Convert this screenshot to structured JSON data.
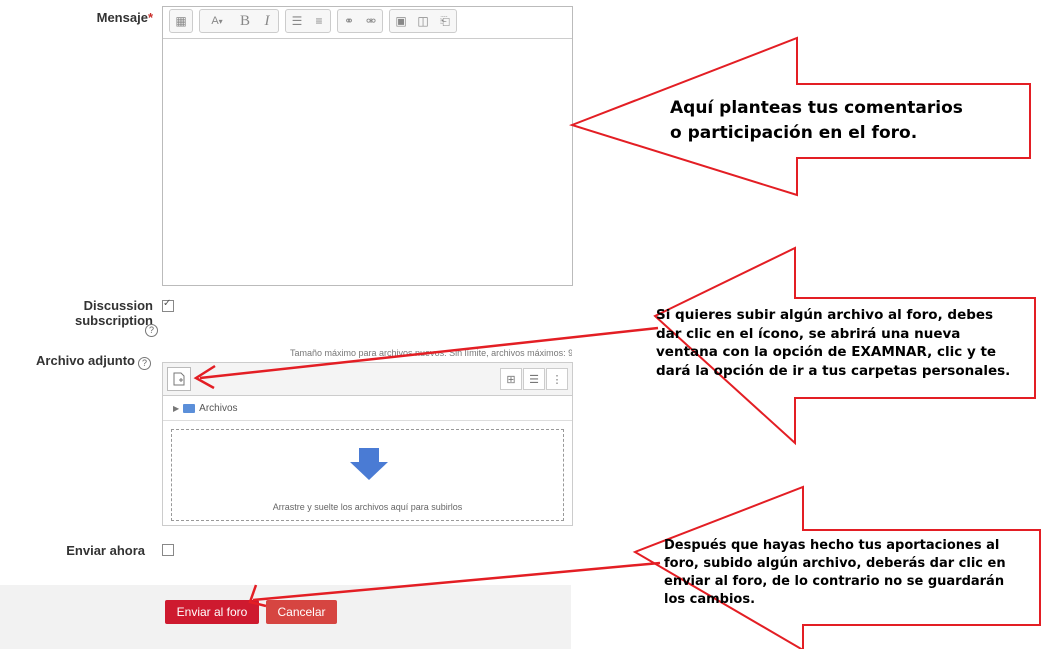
{
  "form": {
    "message_label": "Mensaje",
    "required_mark": "*",
    "subscription_label": "Discussion subscription",
    "attachment_label": "Archivo adjunto",
    "max_size_text": "Tamaño máximo para archivos nuevos: Sin límite, archivos máximos: 9",
    "folder_label": "Archivos",
    "drop_text": "Arrastre y suelte los archivos aquí para subirlos",
    "send_now_label": "Enviar ahora",
    "help_glyph": "?",
    "submit_label": "Enviar al foro",
    "cancel_label": "Cancelar"
  },
  "toolbar": {
    "font_glyph": "A",
    "bold": "B",
    "italic": "I"
  },
  "callouts": {
    "message": [
      "Aquí planteas tus comentarios",
      "o participación en el foro."
    ],
    "attach": [
      "Si quieres subir algún archivo al foro, debes",
      "dar clic en el ícono, se abrirá una nueva",
      "ventana con la opción de EXAMNAR, clic y te",
      "dará la opción de ir a tus carpetas personales."
    ],
    "submit": [
      "Después que hayas hecho tus aportaciones al",
      "foro, subido algún archivo, deberás dar clic en",
      "enviar al foro, de lo contrario no se guardarán",
      "los cambios."
    ]
  },
  "colors": {
    "primary": "#ce1a2f",
    "secondary": "#d64541",
    "arrow": "#e31e24",
    "footer_bg": "#f2f2f2",
    "drop_icon": "#4a7bd4"
  }
}
